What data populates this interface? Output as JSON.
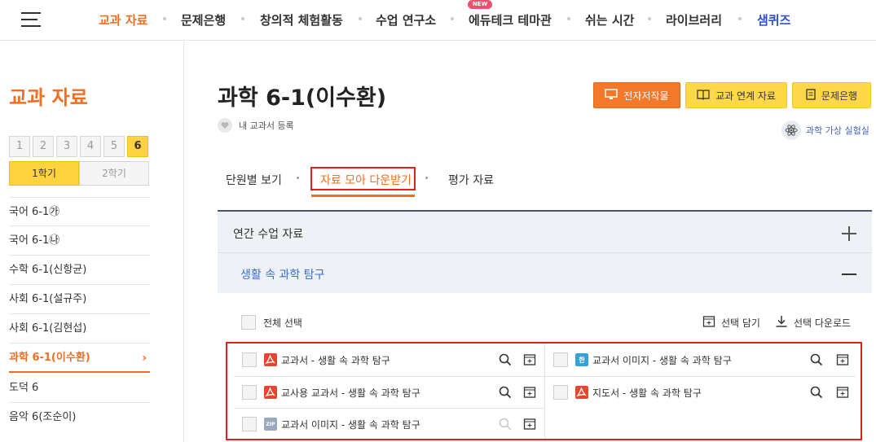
{
  "nav": {
    "items": [
      "교과 자료",
      "문제은행",
      "창의적 체험활동",
      "수업 연구소",
      "에듀테크 테마관",
      "쉬는 시간",
      "라이브러리",
      "샘퀴즈"
    ],
    "new_badge": "NEW",
    "colors": {
      "active": "#f26f21",
      "quiz": "#2d4fd0"
    }
  },
  "sidebar": {
    "title": "교과 자료",
    "grades": [
      "1",
      "2",
      "3",
      "4",
      "5",
      "6"
    ],
    "semesters": [
      "1학기",
      "2학기"
    ],
    "items": [
      "국어 6-1㉮",
      "국어 6-1㉯",
      "수학 6-1(신항균)",
      "사회 6-1(설규주)",
      "사회 6-1(김현섭)",
      "과학 6-1(이수환)",
      "도덕 6",
      "음악 6(조순이)"
    ],
    "active_chevron": "›"
  },
  "main": {
    "title": "과학 6-1(이수환)",
    "fav_label": "내 교과서 등록",
    "buttons": {
      "ebook": "전자저작물",
      "linked": "교과 연계 자료",
      "bank": "문제은행"
    },
    "lab": "과학 가상 실험실",
    "tabs": [
      "단원별 보기",
      "자료 모아 다운받기",
      "평가 자료"
    ],
    "accordion": {
      "header": "연간 수업 자료",
      "sub": "생활 속 과학 탐구"
    },
    "select_all": "전체 선택",
    "actions": {
      "cart": "선택 담기",
      "download": "선택 다운로드"
    },
    "files": [
      {
        "name": "교과서 - 생활 속 과학 탐구",
        "type": "pdf"
      },
      {
        "name": "교과서 이미지 - 생활 속 과학 탐구",
        "type": "img"
      },
      {
        "name": "교사용 교과서 - 생활 속 과학 탐구",
        "type": "pdf"
      },
      {
        "name": "지도서 - 생활 속 과학 탐구",
        "type": "pdf"
      },
      {
        "name": "교과서 이미지 - 생활 속 과학 탐구",
        "type": "zip"
      }
    ],
    "file_type_glyphs": {
      "img": "한",
      "zip": "ZIP"
    }
  }
}
